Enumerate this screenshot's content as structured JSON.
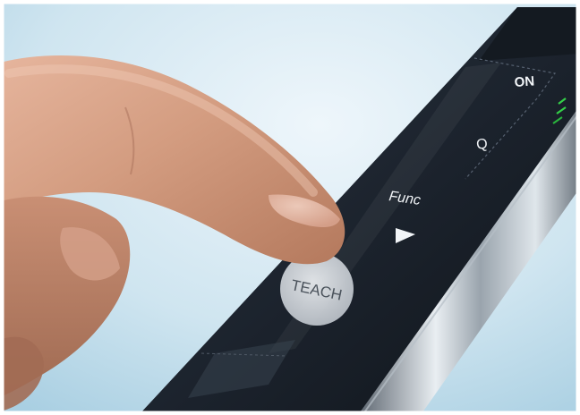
{
  "labels": {
    "on": "ON",
    "q": "Q",
    "func": "Func",
    "teach": "TEACH"
  },
  "icons": {
    "arrow": "play-arrow-icon",
    "indicator": "green-led-icon"
  },
  "colors": {
    "background_light": "#e9f2f8",
    "background_blue": "#bcdbe9",
    "panel_dark": "#1d2530",
    "led_green": "#34d048",
    "teach_button": "#d7dbe0"
  }
}
